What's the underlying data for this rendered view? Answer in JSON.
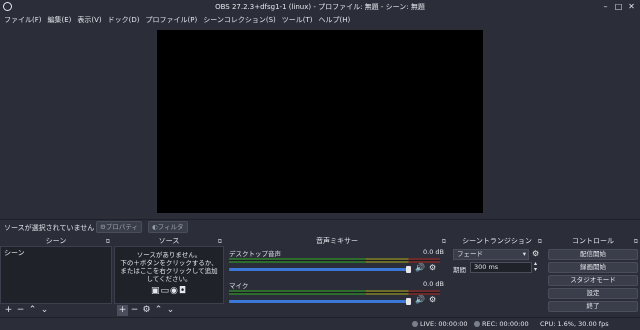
{
  "window": {
    "title": "OBS 27.2.3+dfsg1-1 (linux) - プロファイル: 無題 - シーン: 無題"
  },
  "menu": [
    "ファイル(F)",
    "編集(E)",
    "表示(V)",
    "ドック(D)",
    "プロファイル(P)",
    "シーンコレクション(S)",
    "ツール(T)",
    "ヘルプ(H)"
  ],
  "source_toolbar": {
    "no_selection": "ソースが選択されていません",
    "properties": "プロパティ",
    "filters": "フィルタ"
  },
  "scenes": {
    "title": "シーン",
    "items": [
      "シーン"
    ]
  },
  "sources": {
    "title": "ソース",
    "empty_line1": "ソースがありません。",
    "empty_line2": "下の＋ボタンをクリックするか、",
    "empty_line3": "またはここを右クリックして追加",
    "empty_line4": "してください。"
  },
  "mixer": {
    "title": "音声ミキサー",
    "channels": [
      {
        "name": "デスクトップ音声",
        "db": "0.0 dB"
      },
      {
        "name": "マイク",
        "db": "0.0 dB"
      }
    ]
  },
  "transitions": {
    "title": "シーントランジション",
    "type": "フェード",
    "duration_label": "期間",
    "duration_value": "300 ms"
  },
  "controls": {
    "title": "コントロール",
    "buttons": [
      "配信開始",
      "録画開始",
      "スタジオモード",
      "設定",
      "終了"
    ]
  },
  "status": {
    "live": "LIVE: 00:00:00",
    "rec": "REC: 00:00:00",
    "cpu": "CPU: 1.6%, 30.00 fps"
  }
}
